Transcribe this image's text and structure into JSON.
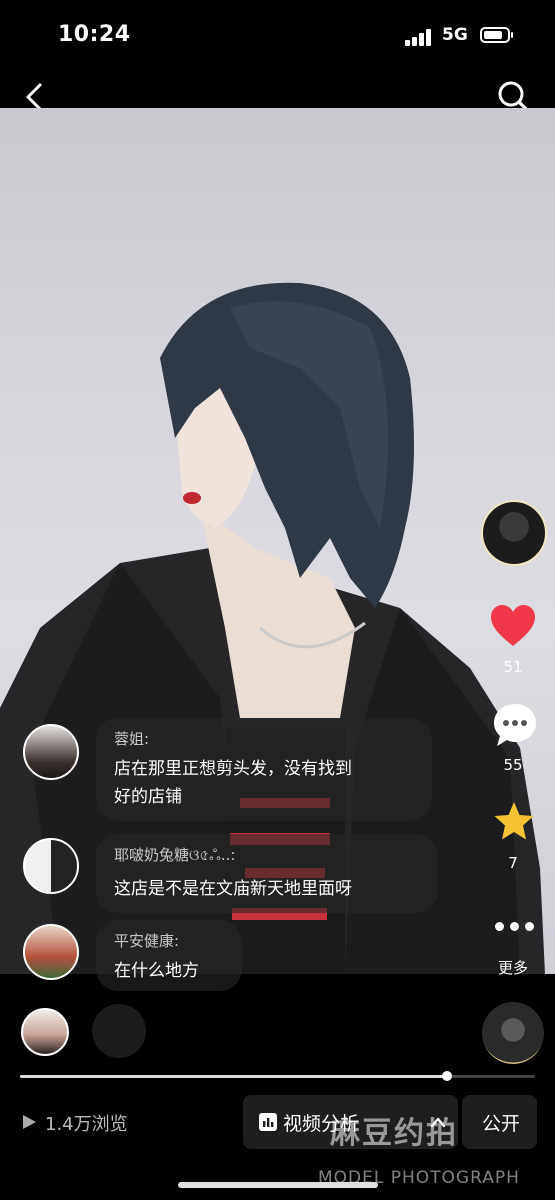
{
  "status_bar": {
    "time": "10:24",
    "network": "5G"
  },
  "nav": {
    "back_icon": "chevron-left-icon",
    "search_icon": "search-icon"
  },
  "actions": {
    "like_count": "51",
    "comment_count": "55",
    "favorite_count": "7",
    "more_label": "更多"
  },
  "comments": [
    {
      "user": "蓉姐:",
      "text_line1": "店在那里正想剪头发，没有找到",
      "text_line2": "好的店铺"
    },
    {
      "user": "耶啵奶兔糖ଓ৫ஃ..:",
      "text_line1": "这店是不是在文庙新天地里面呀"
    },
    {
      "user": "平安健康:",
      "text_line1": "在什么地方"
    }
  ],
  "footer": {
    "views": "1.4万浏览",
    "analysis_label": "视频分析",
    "public_label": "公开",
    "progress": 0.83
  },
  "watermark": {
    "title": "麻豆约拍",
    "subtitle": "MODEL PHOTOGRAPH"
  },
  "colors": {
    "like": "#f0384a",
    "favorite": "#f7c233",
    "background": "#000000"
  }
}
